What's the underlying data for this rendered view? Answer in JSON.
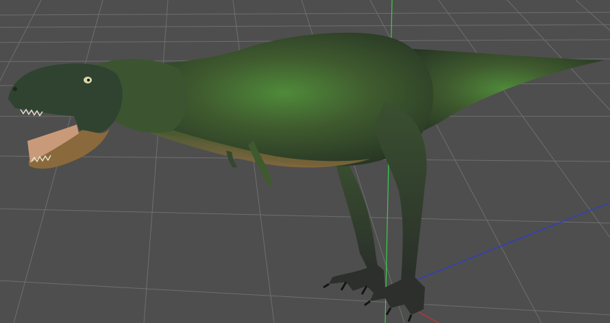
{
  "viewport": {
    "background_color": "#4e4e4e",
    "grid_color": "#6f6f6f",
    "axis_colors": {
      "x": "#c8323c",
      "y": "#3ad04a",
      "z": "#2b3bd6"
    }
  },
  "scene": {
    "model": "dinosaur-model",
    "skin_colors": {
      "dark": "#2a3a28",
      "mid": "#3f5a2e",
      "bright": "#4f8a3a",
      "tan": "#8a6a3c",
      "mouth": "#c99a7a",
      "claw": "#1a1a1a"
    }
  }
}
